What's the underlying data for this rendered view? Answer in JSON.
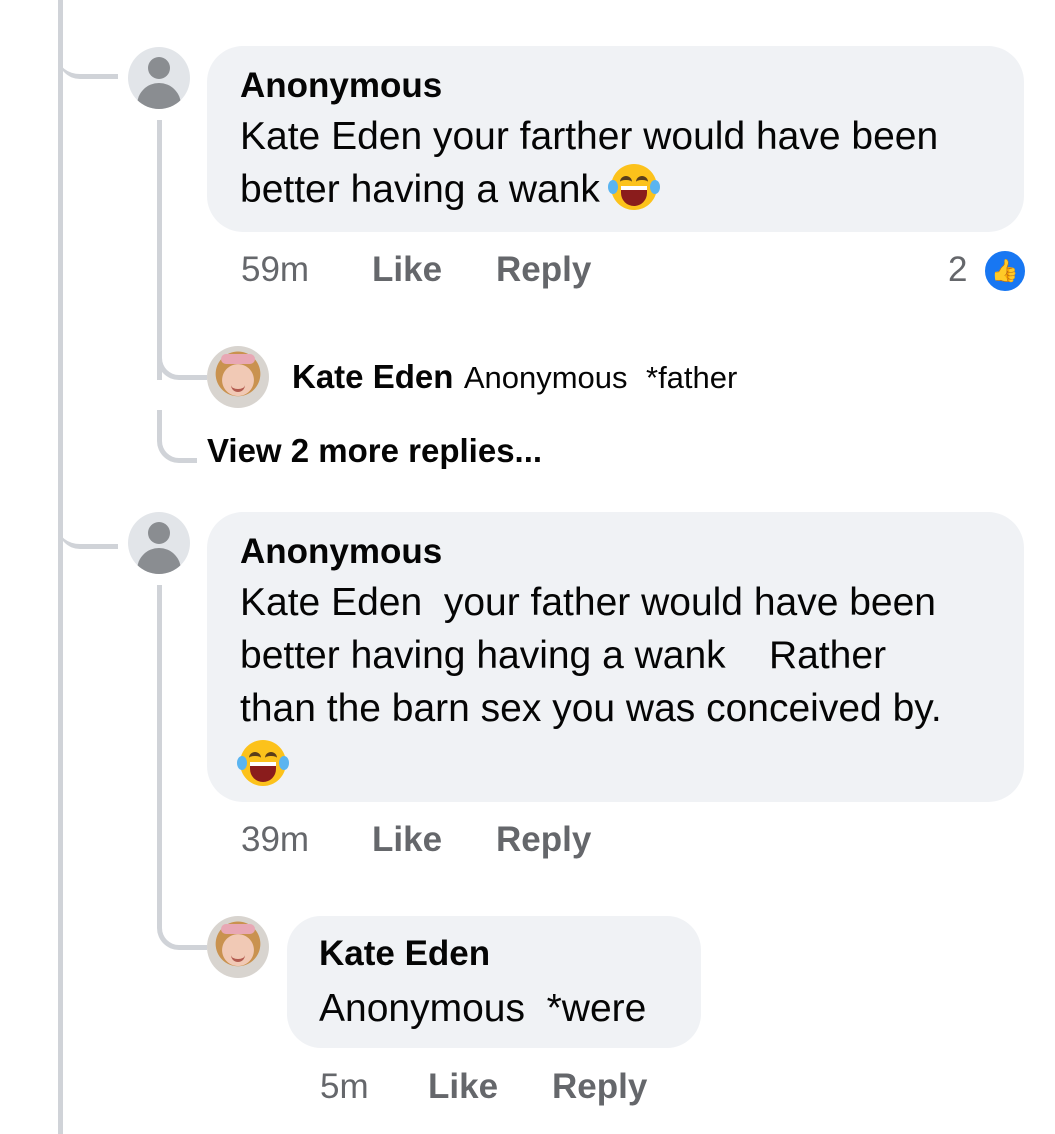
{
  "comments": [
    {
      "author": "Anonymous",
      "text": "Kate Eden your farther would have been better having a wank",
      "emoji": "face-with-tears-of-joy",
      "time": "59m",
      "like_label": "Like",
      "reply_label": "Reply",
      "reaction_count": "2",
      "reaction_icon": "thumbs-up-icon",
      "replies": [
        {
          "author": "Kate Eden",
          "mention": "Anonymous",
          "text": "*father"
        }
      ],
      "view_more": "View 2 more replies..."
    },
    {
      "author": "Anonymous",
      "text_line1": "Kate Eden  your father would have been",
      "text_line2": "better having having a wank    Rather",
      "text_line3": "than the barn sex you was conceived by.",
      "emoji": "face-with-tears-of-joy",
      "time": "39m",
      "like_label": "Like",
      "reply_label": "Reply",
      "replies": [
        {
          "author": "Kate Eden",
          "mention": "Anonymous",
          "text": "*were",
          "time": "5m",
          "like_label": "Like",
          "reply_label": "Reply"
        }
      ]
    }
  ],
  "colors": {
    "bubble": "#f0f2f5",
    "thread_line": "#d0d3d8",
    "meta_text": "#65676b",
    "like_blue": "#1877f2"
  }
}
